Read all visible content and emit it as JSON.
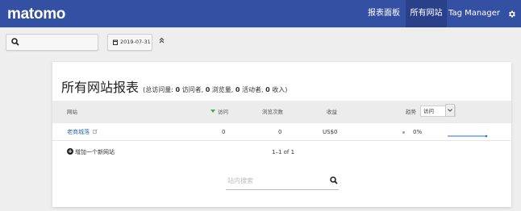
{
  "app": {
    "logo": "matomo"
  },
  "nav": {
    "items": [
      {
        "label": "报表面板"
      },
      {
        "label": "所有网站"
      },
      {
        "label": "Tag Manager"
      }
    ],
    "settings_icon": "gear-icon"
  },
  "toolbar": {
    "search_icon": "search-icon",
    "date": "2019-07-31",
    "calendar_icon": "calendar-icon",
    "collapse_icon": "double-chevron-up-icon"
  },
  "summary": {
    "title": "所有网站报表",
    "open": "(总访问量: ",
    "visits": "0",
    "visits_label": " 访问者, ",
    "pageviews": "0",
    "pageviews_label": " 浏览量, ",
    "actions": "0",
    "actions_label": " 活动者, ",
    "revenue": "0",
    "revenue_label": " 收入)"
  },
  "table": {
    "headers": {
      "website": "网站",
      "visits": "访问",
      "pageviews": "浏览次数",
      "revenue": "收益",
      "trend": "趋势",
      "trend_select": "访问"
    },
    "rows": [
      {
        "site": "老商城落",
        "visits": "0",
        "pageviews": "0",
        "revenue": "US$0",
        "trend": "0%"
      }
    ],
    "sort_color": "#4aa94a"
  },
  "footer": {
    "add_site": "增加一个新网站",
    "pagination": "1–1 of 1"
  },
  "site_search": {
    "placeholder": "站内搜索"
  },
  "colors": {
    "topbar": "#3450a3",
    "topbar_active": "#2a4189",
    "link": "#2f6cbc",
    "sparkline": "#2f6cbc"
  }
}
